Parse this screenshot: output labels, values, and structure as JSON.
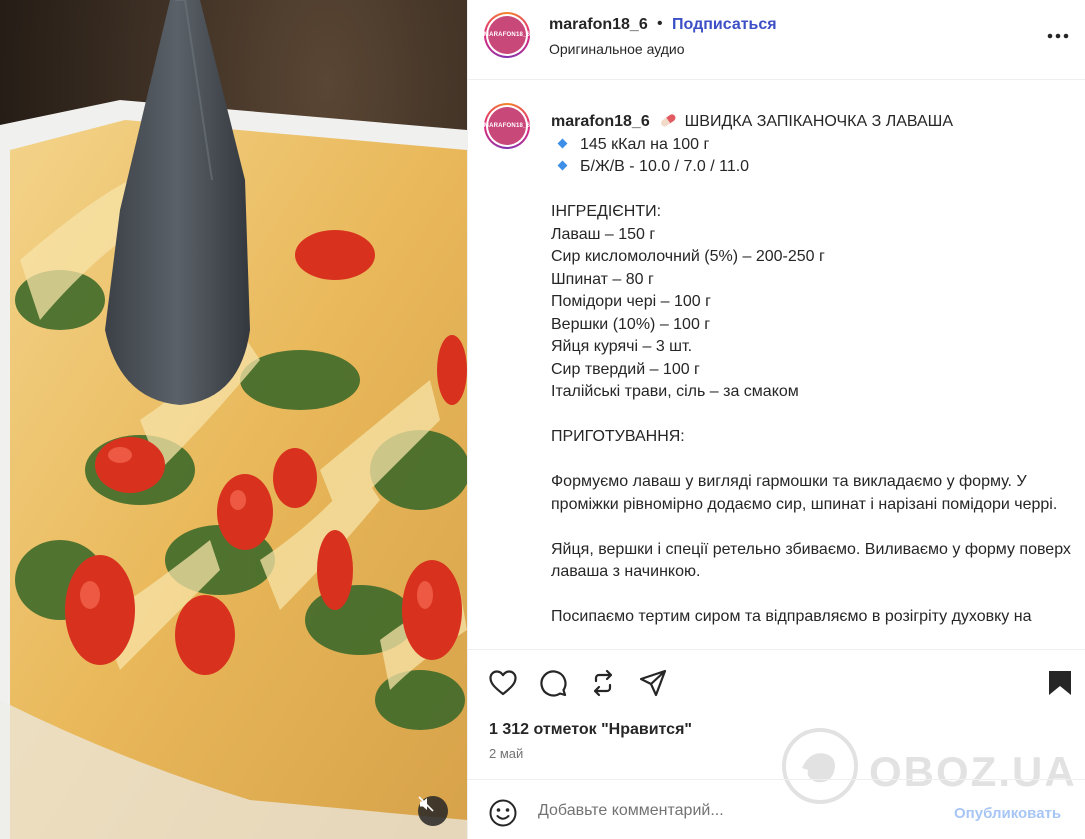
{
  "header": {
    "avatar_text": "MARAFON18_6",
    "username": "marafon18_6",
    "separator": "•",
    "follow_label": "Подписаться",
    "audio_label": "Оригинальное аудио",
    "more_icon": "more-horizontal-icon"
  },
  "caption": {
    "username": "marafon18_6",
    "title": "ШВИДКА ЗАПІКАНОЧКА З ЛАВАША",
    "title_icon": "pill-emoji",
    "bullet_icon": "blue-diamond-emoji",
    "bullets": [
      "145 кКал на 100 г",
      "Б/Ж/В - 10.0 / 7.0 / 11.0"
    ],
    "ingredients_heading": "ІНГРЕДІЄНТИ:",
    "ingredients": [
      "Лаваш – 150 г",
      "Сир кисломолочний (5%) – 200-250 г",
      "Шпинат – 80 г",
      "Помідори чері – 100 г",
      "Вершки (10%) – 100 г",
      "Яйця курячі – 3 шт.",
      "Сир твердий – 100 г",
      "Італійські трави, сіль – за смаком"
    ],
    "method_heading": "ПРИГОТУВАННЯ:",
    "steps": [
      "Формуємо лаваш у вигляді гармошки та викладаємо у форму. У проміжки рівномірно додаємо сир, шпинат і нарізані помідори черрі.",
      "Яйця, вершки і спеції ретельно збиваємо. Виливаємо у форму поверх лаваша з начинкою.",
      "Посипаємо тертим сиром та відправляємо в розігріту духовку на"
    ]
  },
  "actions": {
    "icons": [
      "heart-icon",
      "comment-icon",
      "repost-icon",
      "share-icon",
      "bookmark-icon"
    ],
    "likes_text": "1 312 отметок \"Нравится\"",
    "date_text": "2 май"
  },
  "comment": {
    "placeholder": "Добавьте комментарий...",
    "post_label": "Опубликовать",
    "emoji_icon": "emoji-smile-icon"
  },
  "media": {
    "mute_icon": "speaker-muted-icon"
  },
  "watermark": {
    "text": "OBOZ.UA"
  }
}
